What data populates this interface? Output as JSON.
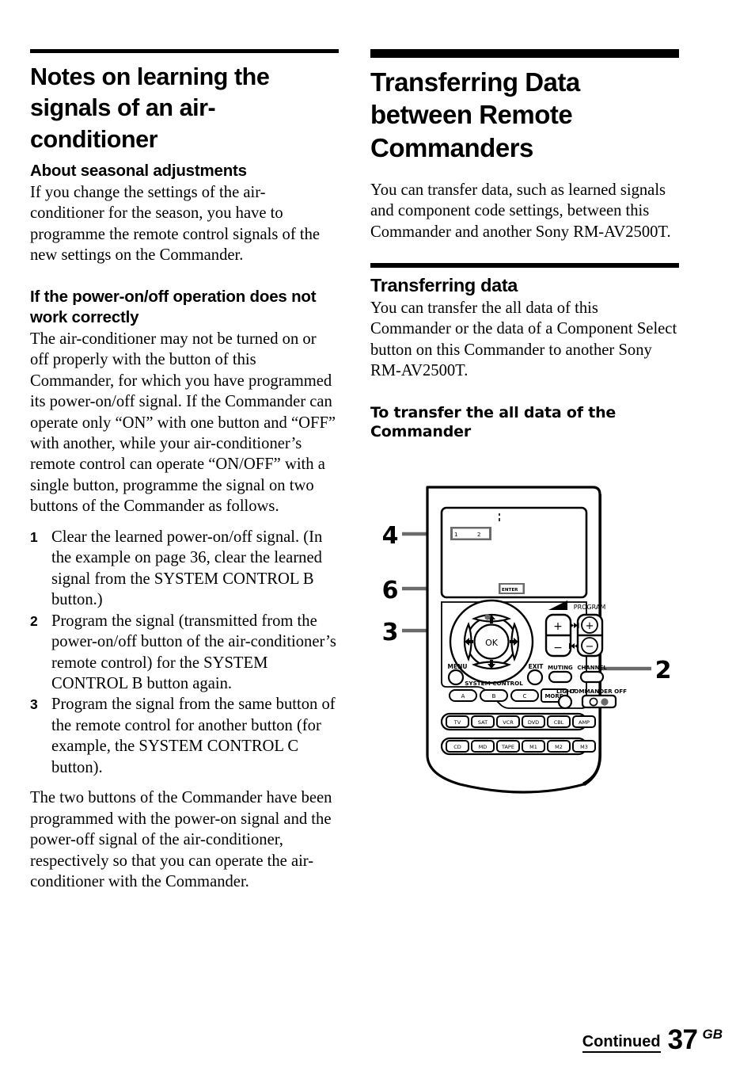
{
  "page": {
    "number": "37",
    "region_suffix": "GB",
    "continued_label": "Continued"
  },
  "left_column": {
    "title": "Notes on learning the signals of an air-conditioner",
    "subsection_1": {
      "heading": "About seasonal adjustments",
      "body": "If you change the settings of the air-conditioner for the season, you have to programme the remote control signals of the new settings on the Commander."
    },
    "subsection_2": {
      "heading": "If the power-on/off operation does not work correctly",
      "body": "The air-conditioner may not be turned on or off properly with the button of this Commander, for which you have programmed its power-on/off signal. If the Commander can operate only “ON” with one button and “OFF” with another, while your air-conditioner’s remote control can operate “ON/OFF” with a single button, programme the signal on two buttons of the Commander as follows.",
      "steps": [
        {
          "num": "1",
          "text": "Clear the learned power-on/off signal. (In the example on page 36, clear the learned signal from the SYSTEM CONTROL B button.)"
        },
        {
          "num": "2",
          "text": "Program the signal (transmitted from the power-on/off button of the air-conditioner’s remote control) for the SYSTEM CONTROL B button again."
        },
        {
          "num": "3",
          "text": "Program the signal from the same button of the remote control for another button (for example, the SYSTEM CONTROL C button)."
        }
      ],
      "closing": "The two buttons of the Commander have been programmed with the power-on signal and the power-off signal of the air-conditioner, respectively so that you can operate the air-conditioner with the Commander."
    }
  },
  "right_column": {
    "title": "Transferring Data between Remote Commanders",
    "intro": "You can transfer data, such as learned signals and component code settings, between this Commander and another Sony RM-AV2500T.",
    "section": {
      "heading": "Transferring data",
      "body": "You can transfer the all data of this Commander or the data of a Component Select button on this Commander to another Sony RM-AV2500T."
    },
    "procedure_heading": "To transfer the all data of the Commander"
  },
  "figure": {
    "callouts": [
      {
        "id": "callout-4",
        "label": "4"
      },
      {
        "id": "callout-6",
        "label": "6"
      },
      {
        "id": "callout-3",
        "label": "3"
      },
      {
        "id": "callout-2",
        "label": "2"
      }
    ],
    "lcd": {
      "page_indicator_1": "1",
      "page_indicator_2": "2",
      "enter_label": "ENTER"
    },
    "controls": {
      "ok_label": "OK",
      "menu_label": "MENU",
      "exit_label": "EXIT",
      "system_control_label": "SYSTEM CONTROL",
      "system_control_buttons": [
        "A",
        "B",
        "C",
        "MORE"
      ],
      "program_label": "PROGRAM",
      "muting_label": "MUTING",
      "channel_label": "CHANNEL",
      "light_label": "LIGHT",
      "commander_off_label": "COMMANDER OFF",
      "volume_plus": "+",
      "volume_minus": "−",
      "program_plus": "+",
      "program_minus": "−"
    },
    "component_row_1": [
      "TV",
      "SAT",
      "VCR",
      "DVD",
      "CBL",
      "AMP"
    ],
    "component_row_2": [
      "CD",
      "MD",
      "TAPE",
      "M1",
      "M2",
      "M3"
    ]
  },
  "colors": {
    "ink": "#000000",
    "paper": "#ffffff",
    "callout_line": "#6b6b6b",
    "highlight_box": "#6b6b6b"
  }
}
